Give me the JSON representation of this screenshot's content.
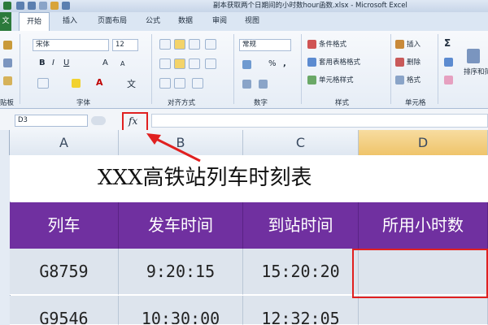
{
  "window": {
    "title": "副本获取两个日期间的小时数hour函数.xlsx - Microsoft Excel"
  },
  "ribbon": {
    "tabs": [
      "文件",
      "开始",
      "插入",
      "页面布局",
      "公式",
      "数据",
      "审阅",
      "视图"
    ],
    "font": {
      "name": "宋体",
      "size": "12",
      "group_label": "字体"
    },
    "alignment": {
      "group_label": "对齐方式"
    },
    "number": {
      "format": "常规",
      "group_label": "数字"
    },
    "styles": {
      "items": [
        "条件格式",
        "套用表格格式",
        "单元格样式"
      ],
      "group_label": "样式"
    },
    "cells": {
      "items": [
        "插入",
        "删除",
        "格式"
      ],
      "group_label": "单元格"
    },
    "editing": {
      "sort_label": "排序和筛选"
    },
    "clipboard": {
      "group_label": "贴板"
    }
  },
  "formula_bar": {
    "name_box": "D3",
    "fx_label": "fx",
    "value": ""
  },
  "columns": [
    "A",
    "B",
    "C",
    "D"
  ],
  "sheet": {
    "title": "XXX高铁站列车时刻表",
    "headers": [
      "列车",
      "发车时间",
      "到站时间",
      "所用小时数"
    ],
    "rows": [
      [
        "G8759",
        "9:20:15",
        "15:20:20",
        ""
      ],
      [
        "G9546",
        "10:30:00",
        "12:32:05",
        ""
      ]
    ]
  },
  "colors": {
    "header_bg": "#7030a0",
    "highlight": "#e02020",
    "cell_bg": "#dde4ed"
  }
}
